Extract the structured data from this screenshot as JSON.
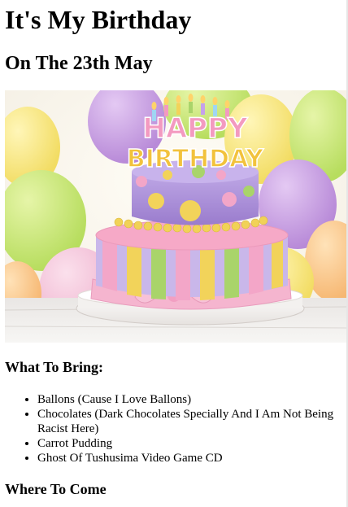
{
  "page": {
    "title": "It's My Birthday",
    "subtitle": "On The 23th May"
  },
  "hero": {
    "cake_topper_line1": "HAPPY",
    "cake_topper_line2": "BIRTHDAY"
  },
  "bring": {
    "heading": "What To Bring:",
    "items": [
      "Ballons (Cause I Love Ballons)",
      "Chocolates (Dark Chocolates Specially And I Am Not Being Racist Here)",
      "Carrot Pudding",
      "Ghost Of Tushusima Video Game CD"
    ]
  },
  "come": {
    "heading": "Where To Come"
  },
  "colors": {
    "background": "#ffffff",
    "text": "#000000",
    "cake_purple": "#a98fd6",
    "cake_pink": "#f3a6c8",
    "cake_yellow": "#f2d35a",
    "cake_green": "#a9d46a"
  }
}
